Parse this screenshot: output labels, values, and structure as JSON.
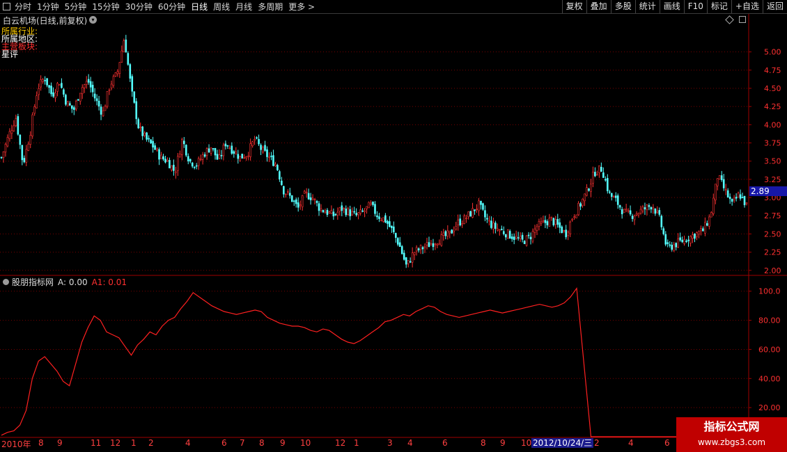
{
  "toolbar": {
    "left_items": [
      "分时",
      "1分钟",
      "5分钟",
      "15分钟",
      "30分钟",
      "60分钟",
      "日线",
      "周线",
      "月线",
      "多周期",
      "更多 >"
    ],
    "active": "日线",
    "right_items": [
      "复权",
      "叠加",
      "多股",
      "统计",
      "画线",
      "F10",
      "标记",
      "+自选",
      "返回"
    ]
  },
  "stock": {
    "title": "白云机场(日线,前复权)",
    "info": [
      {
        "label": "所属行业:",
        "color": "#ffcc00"
      },
      {
        "label": "所属地区:",
        "color": "#ffffff"
      },
      {
        "label": "主营板块:",
        "color": "#ff3030"
      },
      {
        "label": "星评",
        "color": "#ffffff"
      }
    ]
  },
  "price_axis": {
    "ticks": [
      "5.00",
      "4.75",
      "4.50",
      "4.25",
      "4.00",
      "3.75",
      "3.50",
      "3.25",
      "3.00",
      "2.75",
      "2.50",
      "2.25",
      "2.00"
    ],
    "current": "2.89"
  },
  "indicator": {
    "name": "股朋指标网",
    "a_label": "A: 0.00",
    "a1_label": "A1: 0.01",
    "ticks": [
      "100.0",
      "80.00",
      "60.00",
      "40.00",
      "20.00"
    ]
  },
  "x_axis": {
    "labels": [
      "2010年",
      "8",
      "9",
      "11",
      "12",
      "1",
      "2",
      "4",
      "6",
      "7",
      "8",
      "9",
      "10",
      "12",
      "1",
      "3",
      "4",
      "6",
      "8",
      "9",
      "10",
      "2",
      "4",
      "6"
    ],
    "selected_date": "2012/10/24/三"
  },
  "watermark": {
    "line1": "指标公式网",
    "line2": "www.zbgs3.com"
  },
  "chart_data": [
    {
      "type": "candlestick",
      "title": "白云机场(日线,前复权)",
      "ylim": [
        1.95,
        5.35
      ],
      "y_ticks": [
        2.0,
        2.25,
        2.5,
        2.75,
        3.0,
        3.25,
        3.5,
        3.75,
        4.0,
        4.25,
        4.5,
        4.75,
        5.0
      ],
      "x_labels": [
        "2010年",
        "8",
        "9",
        "11",
        "12",
        "1",
        "2",
        "4",
        "6",
        "7",
        "8",
        "9",
        "10",
        "12",
        "1",
        "3",
        "4",
        "6",
        "8",
        "9",
        "10",
        "2",
        "4",
        "6"
      ],
      "close_path": [
        3.55,
        3.85,
        4.1,
        3.45,
        3.9,
        4.5,
        4.65,
        4.4,
        4.6,
        4.3,
        4.2,
        4.5,
        4.6,
        4.35,
        4.15,
        4.55,
        4.7,
        5.2,
        4.45,
        3.95,
        3.8,
        3.7,
        3.55,
        3.5,
        3.35,
        3.8,
        3.5,
        3.45,
        3.6,
        3.7,
        3.5,
        3.75,
        3.65,
        3.55,
        3.6,
        3.8,
        3.65,
        3.55,
        3.45,
        3.1,
        3.0,
        2.85,
        3.05,
        3.0,
        2.85,
        2.8,
        2.75,
        2.85,
        2.8,
        2.75,
        2.8,
        2.9,
        2.75,
        2.7,
        2.55,
        2.35,
        2.05,
        2.25,
        2.3,
        2.35,
        2.4,
        2.45,
        2.5,
        2.65,
        2.7,
        2.8,
        2.9,
        2.7,
        2.6,
        2.55,
        2.5,
        2.45,
        2.4,
        2.45,
        2.6,
        2.65,
        2.7,
        2.6,
        2.5,
        2.75,
        2.9,
        3.1,
        3.35,
        3.4,
        3.05,
        2.95,
        2.8,
        2.75,
        2.8,
        2.85,
        2.9,
        2.7,
        2.3,
        2.35,
        2.4,
        2.45,
        2.5,
        2.55,
        2.75,
        3.3,
        3.1,
        2.9,
        3.05,
        2.89
      ],
      "current": 2.89
    },
    {
      "type": "line",
      "series": [
        {
          "name": "A1",
          "color": "#ff2020"
        }
      ],
      "ylim": [
        0,
        108
      ],
      "y_ticks": [
        20,
        40,
        60,
        80,
        100
      ],
      "values": [
        1,
        3,
        4,
        8,
        18,
        40,
        52,
        55,
        50,
        45,
        38,
        35,
        50,
        65,
        75,
        83,
        80,
        72,
        70,
        68,
        62,
        56,
        63,
        67,
        72,
        70,
        76,
        80,
        82,
        88,
        93,
        99,
        96,
        93,
        90,
        88,
        86,
        85,
        84,
        85,
        86,
        87,
        86,
        82,
        80,
        78,
        77,
        76,
        76,
        75,
        73,
        72,
        74,
        73,
        70,
        67,
        65,
        64,
        66,
        69,
        72,
        75,
        79,
        80,
        82,
        84,
        83,
        86,
        88,
        90,
        89,
        86,
        84,
        83,
        82,
        83,
        84,
        85,
        86,
        87,
        86,
        85,
        86,
        87,
        88,
        89,
        90,
        91,
        90,
        89,
        90,
        92,
        96,
        102,
        0.01,
        0.01,
        0.01,
        0.01,
        0.01,
        0.01,
        0.01,
        0.01,
        0.01,
        0.01,
        0.01,
        0.01
      ]
    }
  ]
}
